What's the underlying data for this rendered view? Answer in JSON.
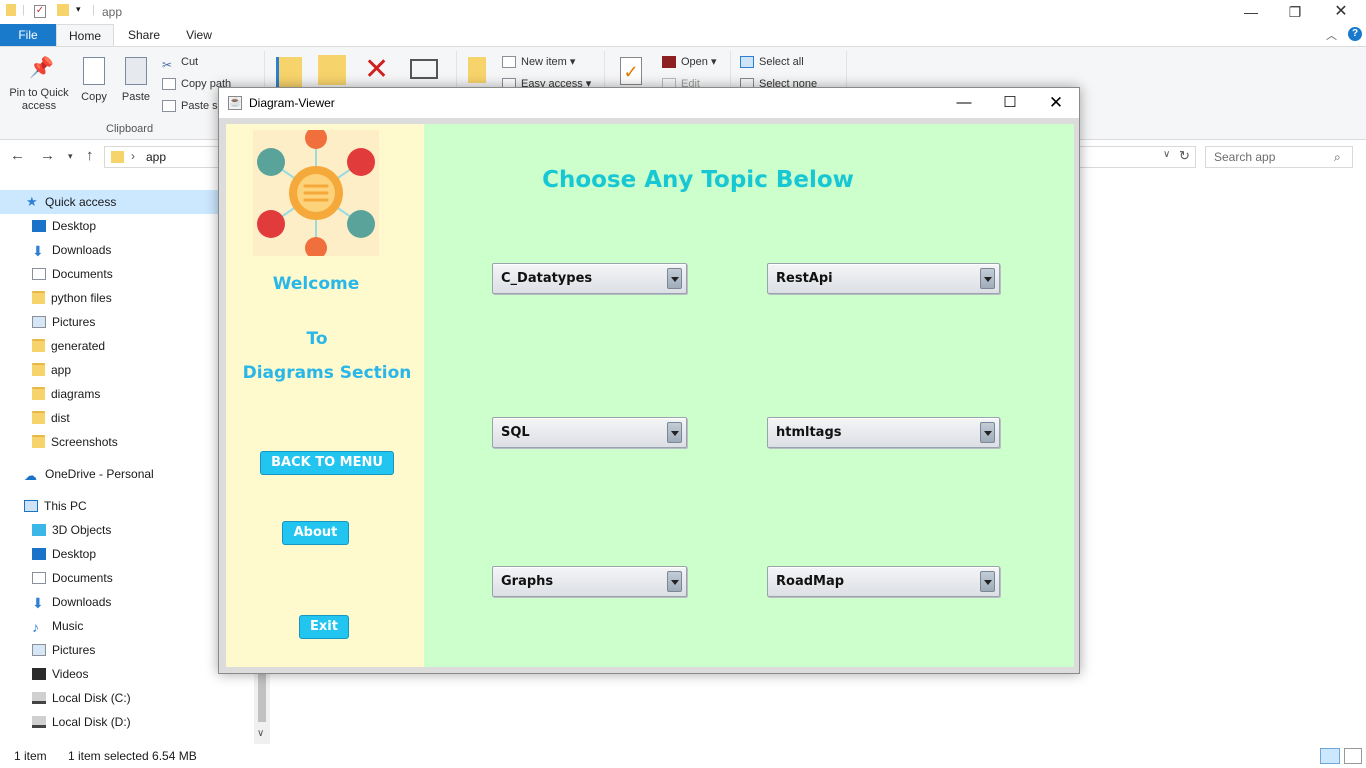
{
  "explorer": {
    "title": "app",
    "tabs": {
      "file": "File",
      "home": "Home",
      "share": "Share",
      "view": "View"
    },
    "ribbon": {
      "pin": "Pin to Quick access",
      "copy": "Copy",
      "paste": "Paste",
      "cut": "Cut",
      "copy_path": "Copy path",
      "paste_shortcut": "Paste sh",
      "clipboard_group": "Clipboard",
      "new_item": "New item ▾",
      "easy_access": "Easy access ▾",
      "open": "Open ▾",
      "edit": "Edit",
      "select_all": "Select all",
      "select_none": "Select none"
    },
    "address": {
      "path": "app",
      "search_placeholder": "Search app"
    },
    "sidebar": {
      "quick_access": "Quick access",
      "quick_items": [
        "Desktop",
        "Downloads",
        "Documents",
        "python files",
        "Pictures",
        "generated",
        "app",
        "diagrams",
        "dist",
        "Screenshots"
      ],
      "onedrive": "OneDrive - Personal",
      "this_pc": "This PC",
      "pc_items": [
        "3D Objects",
        "Desktop",
        "Documents",
        "Downloads",
        "Music",
        "Pictures",
        "Videos",
        "Local Disk (C:)",
        "Local Disk (D:)"
      ]
    },
    "status": {
      "items": "1 item",
      "selected": "1 item selected  6.54 MB"
    }
  },
  "diagram_viewer": {
    "title": "Diagram-Viewer",
    "welcome": "Welcome",
    "to": "To",
    "section": "Diagrams Section",
    "back_button": "BACK TO MENU",
    "about_button": "About",
    "exit_button": "Exit",
    "heading": "Choose Any Topic Below",
    "topics": [
      "C_Datatypes",
      "RestApi",
      "SQL",
      "htmltags",
      "Graphs",
      "RoadMap"
    ]
  },
  "colors": {
    "left_panel": "#fffacd",
    "right_panel": "#ccffcc",
    "accent": "#22c5ef",
    "heading": "#17c8d4"
  }
}
